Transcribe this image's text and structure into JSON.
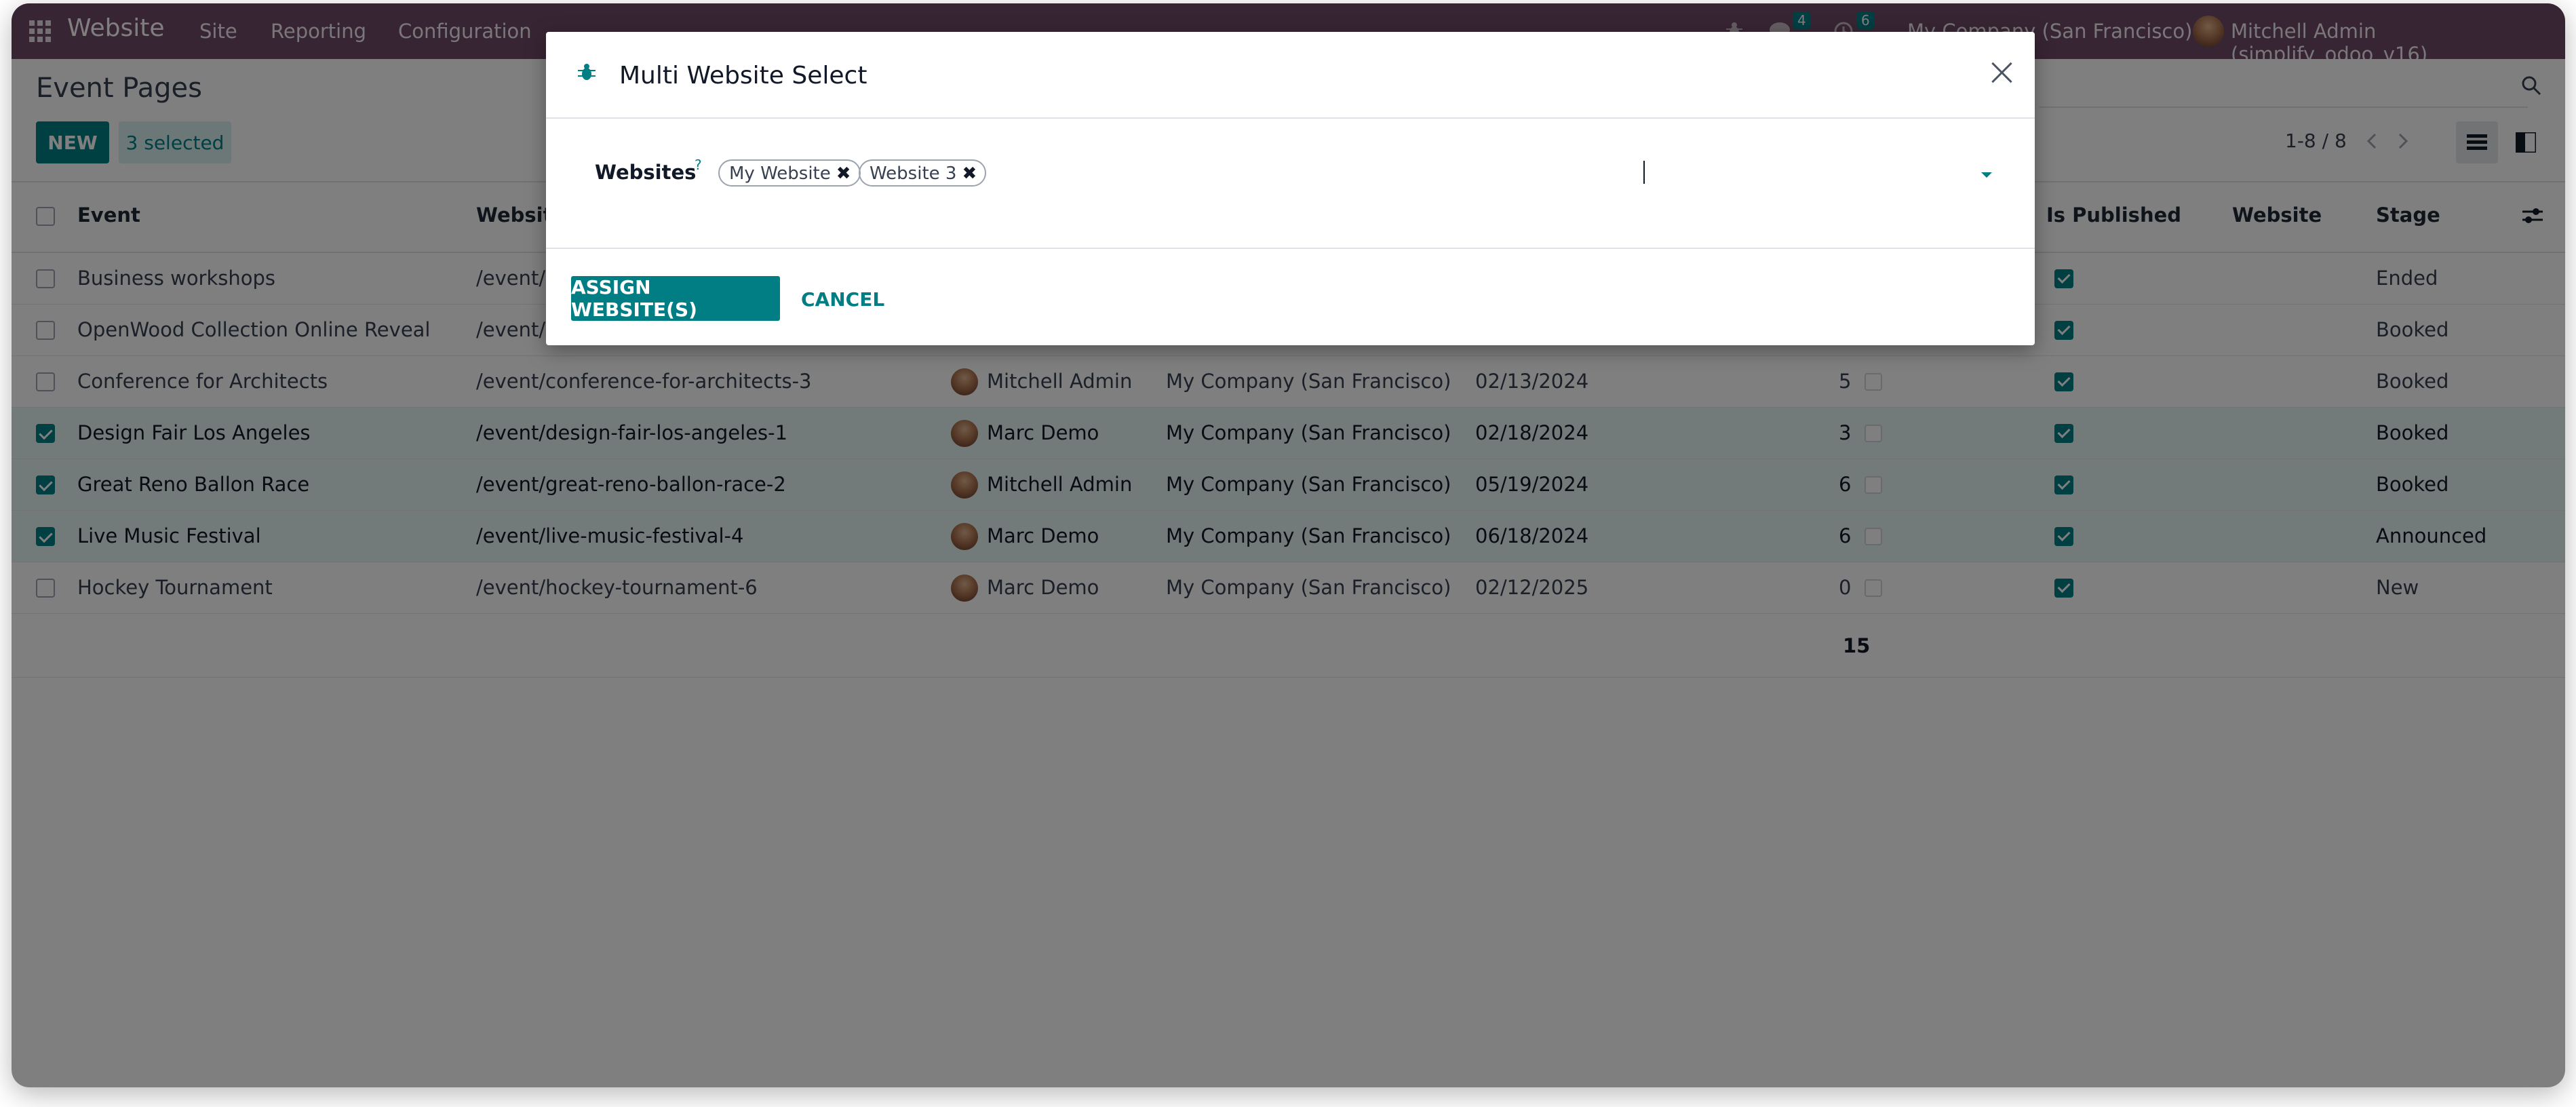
{
  "navbar": {
    "brand": "Website",
    "menu": [
      "Site",
      "Reporting",
      "Configuration"
    ],
    "messages_count": "4",
    "activities_count": "6",
    "company": "My Company (San Francisco)",
    "user": "Mitchell Admin (simplify_odoo_v16)"
  },
  "control_panel": {
    "title": "Event Pages",
    "new_label": "NEW",
    "selected_label": "3 selected",
    "pager": "1-8 / 8"
  },
  "table": {
    "columns": {
      "event": "Event",
      "website": "Website",
      "is_published": "Is Published",
      "website2": "Website",
      "stage": "Stage"
    },
    "rows": [
      {
        "event": "Business workshops",
        "url": "/event/l",
        "user": "",
        "company": "",
        "date": "",
        "count": "",
        "stage": "Ended",
        "selected": false
      },
      {
        "event": "OpenWood Collection Online Reveal",
        "url": "/event/c",
        "user": "",
        "company": "",
        "date": "",
        "count": "",
        "stage": "Booked",
        "selected": false
      },
      {
        "event": "Conference for Architects",
        "url": "/event/conference-for-architects-3",
        "user": "Mitchell Admin",
        "company": "My Company (San Francisco)",
        "date": "02/13/2024",
        "count": "5",
        "stage": "Booked",
        "selected": false
      },
      {
        "event": "Design Fair Los Angeles",
        "url": "/event/design-fair-los-angeles-1",
        "user": "Marc Demo",
        "company": "My Company (San Francisco)",
        "date": "02/18/2024",
        "count": "3",
        "stage": "Booked",
        "selected": true
      },
      {
        "event": "Great Reno Ballon Race",
        "url": "/event/great-reno-ballon-race-2",
        "user": "Mitchell Admin",
        "company": "My Company (San Francisco)",
        "date": "05/19/2024",
        "count": "6",
        "stage": "Booked",
        "selected": true
      },
      {
        "event": "Live Music Festival",
        "url": "/event/live-music-festival-4",
        "user": "Marc Demo",
        "company": "My Company (San Francisco)",
        "date": "06/18/2024",
        "count": "6",
        "stage": "Announced",
        "selected": true
      },
      {
        "event": "Hockey Tournament",
        "url": "/event/hockey-tournament-6",
        "user": "Marc Demo",
        "company": "My Company (San Francisco)",
        "date": "02/12/2025",
        "count": "0",
        "stage": "New",
        "selected": false
      }
    ],
    "total": "15"
  },
  "modal": {
    "title": "Multi Website Select",
    "field_label": "Websites",
    "help": "?",
    "tags": [
      "My Website",
      "Website 3"
    ],
    "assign_label": "ASSIGN WEBSITE(S)",
    "cancel_label": "CANCEL"
  },
  "colors": {
    "brand": "#714b67",
    "accent": "#017e84"
  }
}
